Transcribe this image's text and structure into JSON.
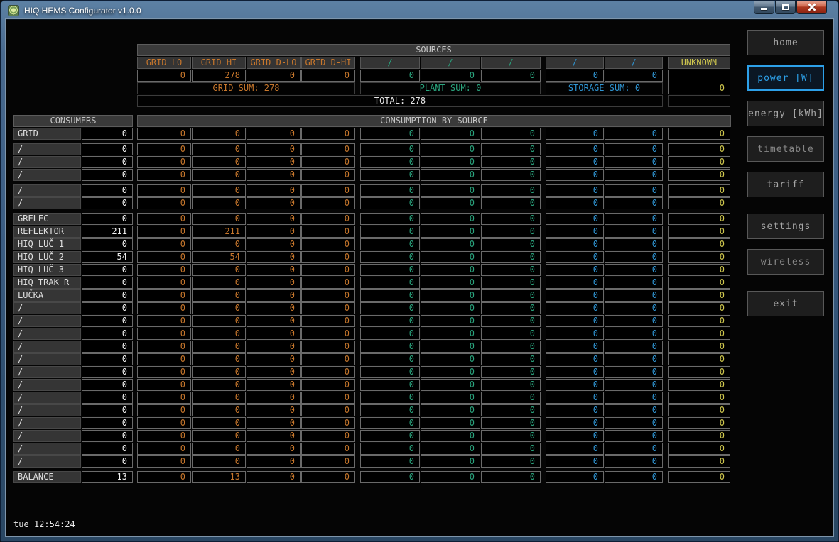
{
  "window": {
    "title": "HIQ HEMS Configurator v1.0.0"
  },
  "colors": {
    "grid": "#c8772c",
    "plant": "#2aa57e",
    "storage": "#3096d4",
    "unknown": "#d0c84e",
    "active": "#2da0e8"
  },
  "sources": {
    "title": "SOURCES",
    "columns": [
      {
        "label": "GRID LO",
        "value": "0",
        "group": "grid"
      },
      {
        "label": "GRID HI",
        "value": "278",
        "group": "grid"
      },
      {
        "label": "GRID D-LO",
        "value": "0",
        "group": "grid"
      },
      {
        "label": "GRID D-HI",
        "value": "0",
        "group": "grid"
      },
      {
        "label": "/",
        "value": "0",
        "group": "plant"
      },
      {
        "label": "/",
        "value": "0",
        "group": "plant"
      },
      {
        "label": "/",
        "value": "0",
        "group": "plant"
      },
      {
        "label": "/",
        "value": "0",
        "group": "storage"
      },
      {
        "label": "/",
        "value": "0",
        "group": "storage"
      },
      {
        "label": "UNKNOWN",
        "value": "0",
        "group": "unknown"
      }
    ],
    "sums": [
      {
        "label": "GRID SUM:",
        "value": "278",
        "group": "grid"
      },
      {
        "label": "PLANT SUM:",
        "value": "0",
        "group": "plant"
      },
      {
        "label": "STORAGE SUM:",
        "value": "0",
        "group": "storage"
      }
    ],
    "total": {
      "label": "TOTAL:",
      "value": "278"
    }
  },
  "consumers": {
    "title": "CONSUMERS",
    "groups": [
      [
        {
          "label": "GRID",
          "value": "0"
        }
      ],
      [
        {
          "label": "/",
          "value": "0"
        },
        {
          "label": "/",
          "value": "0"
        },
        {
          "label": "/",
          "value": "0"
        }
      ],
      [
        {
          "label": "/",
          "value": "0"
        },
        {
          "label": "/",
          "value": "0"
        }
      ],
      [
        {
          "label": "GRELEC",
          "value": "0"
        },
        {
          "label": "REFLEKTOR",
          "value": "211"
        },
        {
          "label": "HIQ LUČ 1",
          "value": "0"
        },
        {
          "label": "HIQ LUČ 2",
          "value": "54"
        },
        {
          "label": "HIQ LUČ 3",
          "value": "0"
        },
        {
          "label": "HIQ TRAK R",
          "value": "0"
        },
        {
          "label": "LUČKA",
          "value": "0"
        },
        {
          "label": "/",
          "value": "0"
        },
        {
          "label": "/",
          "value": "0"
        },
        {
          "label": "/",
          "value": "0"
        },
        {
          "label": "/",
          "value": "0"
        },
        {
          "label": "/",
          "value": "0"
        },
        {
          "label": "/",
          "value": "0"
        },
        {
          "label": "/",
          "value": "0"
        },
        {
          "label": "/",
          "value": "0"
        },
        {
          "label": "/",
          "value": "0"
        },
        {
          "label": "/",
          "value": "0"
        },
        {
          "label": "/",
          "value": "0"
        },
        {
          "label": "/",
          "value": "0"
        },
        {
          "label": "/",
          "value": "0"
        }
      ],
      [
        {
          "label": "BALANCE",
          "value": "13"
        }
      ]
    ]
  },
  "consumption": {
    "title": "CONSUMPTION BY SOURCE",
    "groups": [
      [
        [
          "0",
          "0",
          "0",
          "0",
          "0",
          "0",
          "0",
          "0",
          "0",
          "0"
        ]
      ],
      [
        [
          "0",
          "0",
          "0",
          "0",
          "0",
          "0",
          "0",
          "0",
          "0",
          "0"
        ],
        [
          "0",
          "0",
          "0",
          "0",
          "0",
          "0",
          "0",
          "0",
          "0",
          "0"
        ],
        [
          "0",
          "0",
          "0",
          "0",
          "0",
          "0",
          "0",
          "0",
          "0",
          "0"
        ]
      ],
      [
        [
          "0",
          "0",
          "0",
          "0",
          "0",
          "0",
          "0",
          "0",
          "0",
          "0"
        ],
        [
          "0",
          "0",
          "0",
          "0",
          "0",
          "0",
          "0",
          "0",
          "0",
          "0"
        ]
      ],
      [
        [
          "0",
          "0",
          "0",
          "0",
          "0",
          "0",
          "0",
          "0",
          "0",
          "0"
        ],
        [
          "0",
          "211",
          "0",
          "0",
          "0",
          "0",
          "0",
          "0",
          "0",
          "0"
        ],
        [
          "0",
          "0",
          "0",
          "0",
          "0",
          "0",
          "0",
          "0",
          "0",
          "0"
        ],
        [
          "0",
          "54",
          "0",
          "0",
          "0",
          "0",
          "0",
          "0",
          "0",
          "0"
        ],
        [
          "0",
          "0",
          "0",
          "0",
          "0",
          "0",
          "0",
          "0",
          "0",
          "0"
        ],
        [
          "0",
          "0",
          "0",
          "0",
          "0",
          "0",
          "0",
          "0",
          "0",
          "0"
        ],
        [
          "0",
          "0",
          "0",
          "0",
          "0",
          "0",
          "0",
          "0",
          "0",
          "0"
        ],
        [
          "0",
          "0",
          "0",
          "0",
          "0",
          "0",
          "0",
          "0",
          "0",
          "0"
        ],
        [
          "0",
          "0",
          "0",
          "0",
          "0",
          "0",
          "0",
          "0",
          "0",
          "0"
        ],
        [
          "0",
          "0",
          "0",
          "0",
          "0",
          "0",
          "0",
          "0",
          "0",
          "0"
        ],
        [
          "0",
          "0",
          "0",
          "0",
          "0",
          "0",
          "0",
          "0",
          "0",
          "0"
        ],
        [
          "0",
          "0",
          "0",
          "0",
          "0",
          "0",
          "0",
          "0",
          "0",
          "0"
        ],
        [
          "0",
          "0",
          "0",
          "0",
          "0",
          "0",
          "0",
          "0",
          "0",
          "0"
        ],
        [
          "0",
          "0",
          "0",
          "0",
          "0",
          "0",
          "0",
          "0",
          "0",
          "0"
        ],
        [
          "0",
          "0",
          "0",
          "0",
          "0",
          "0",
          "0",
          "0",
          "0",
          "0"
        ],
        [
          "0",
          "0",
          "0",
          "0",
          "0",
          "0",
          "0",
          "0",
          "0",
          "0"
        ],
        [
          "0",
          "0",
          "0",
          "0",
          "0",
          "0",
          "0",
          "0",
          "0",
          "0"
        ],
        [
          "0",
          "0",
          "0",
          "0",
          "0",
          "0",
          "0",
          "0",
          "0",
          "0"
        ],
        [
          "0",
          "0",
          "0",
          "0",
          "0",
          "0",
          "0",
          "0",
          "0",
          "0"
        ],
        [
          "0",
          "0",
          "0",
          "0",
          "0",
          "0",
          "0",
          "0",
          "0",
          "0"
        ]
      ],
      [
        [
          "0",
          "13",
          "0",
          "0",
          "0",
          "0",
          "0",
          "0",
          "0",
          "0"
        ]
      ]
    ]
  },
  "sidebar": {
    "buttons": [
      {
        "label": "home",
        "active": false,
        "muted": false,
        "gap_before": false
      },
      {
        "label": "power [W]",
        "active": true,
        "muted": false,
        "gap_before": false
      },
      {
        "label": "energy [kWh]",
        "active": false,
        "muted": false,
        "gap_before": false
      },
      {
        "label": "timetable",
        "active": false,
        "muted": true,
        "gap_before": false
      },
      {
        "label": "tariff",
        "active": false,
        "muted": false,
        "gap_before": false
      },
      {
        "label": "settings",
        "active": false,
        "muted": false,
        "gap_before": true
      },
      {
        "label": "wireless",
        "active": false,
        "muted": true,
        "gap_before": false
      },
      {
        "label": "exit",
        "active": false,
        "muted": false,
        "gap_before": true
      }
    ]
  },
  "statusbar": {
    "clock": "tue 12:54:24"
  }
}
